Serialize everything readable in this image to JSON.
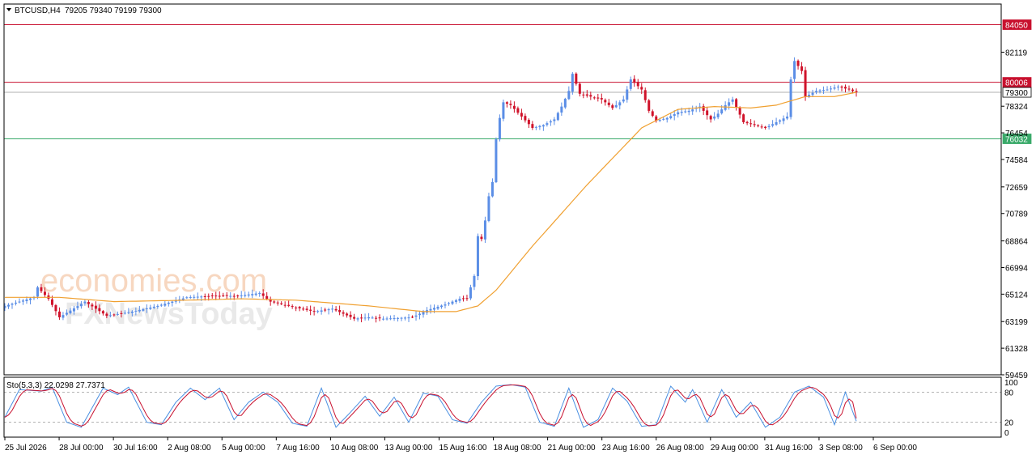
{
  "header": {
    "symbol_label": "BTCUSD,H4",
    "ohlc_label": "79205 79340 79199 79300"
  },
  "watermarks": [
    "economies.com",
    "FXNewsToday"
  ],
  "colors": {
    "bull": "#5b8ee6",
    "bear": "#d0122a",
    "ma": "#f0a030",
    "resistance": "#c8102e",
    "support": "#3aaa6a",
    "price_line": "#b0b0b0",
    "stoch_main": "#4a90e2",
    "stoch_signal": "#c8102e"
  },
  "chart_data": [
    {
      "type": "candlestick",
      "symbol": "BTCUSD",
      "timeframe": "H4",
      "ylim": [
        59459,
        85500
      ],
      "y_ticks": [
        "82119",
        "80006",
        "79300",
        "78324",
        "76454",
        "74584",
        "72659",
        "70789",
        "68864",
        "66994",
        "65124",
        "63199",
        "61328",
        "59459"
      ],
      "x_ticks": [
        "25 Jul 2026",
        "28 Jul 00:00",
        "30 Jul 16:00",
        "2 Aug 08:00",
        "5 Aug 00:00",
        "7 Aug 16:00",
        "10 Aug 08:00",
        "13 Aug 00:00",
        "15 Aug 16:00",
        "18 Aug 08:00",
        "21 Aug 00:00",
        "23 Aug 16:00",
        "26 Aug 08:00",
        "29 Aug 00:00",
        "31 Aug 16:00",
        "3 Sep 08:00",
        "6 Sep 00:00"
      ],
      "levels": [
        {
          "label": "84050",
          "value": 84050,
          "role": "resistance"
        },
        {
          "label": "80006",
          "value": 80006,
          "role": "resistance"
        },
        {
          "label": "79300",
          "value": 79300,
          "role": "current"
        },
        {
          "label": "76032",
          "value": 76032,
          "role": "support"
        }
      ],
      "close_anchors": [
        [
          0,
          64300
        ],
        [
          8,
          64900
        ],
        [
          9,
          65600
        ],
        [
          12,
          64800
        ],
        [
          15,
          63500
        ],
        [
          22,
          64600
        ],
        [
          28,
          63600
        ],
        [
          35,
          63900
        ],
        [
          42,
          64300
        ],
        [
          50,
          64900
        ],
        [
          57,
          65000
        ],
        [
          64,
          65000
        ],
        [
          70,
          65200
        ],
        [
          73,
          64600
        ],
        [
          78,
          64300
        ],
        [
          85,
          63900
        ],
        [
          90,
          64100
        ],
        [
          96,
          63400
        ],
        [
          100,
          63500
        ],
        [
          104,
          63400
        ],
        [
          112,
          63500
        ],
        [
          116,
          64000
        ],
        [
          121,
          64400
        ],
        [
          125,
          64800
        ],
        [
          127,
          64800
        ],
        [
          129,
          66400
        ],
        [
          130,
          69200
        ],
        [
          131,
          69000
        ],
        [
          132,
          70300
        ],
        [
          133,
          72000
        ],
        [
          134,
          73000
        ],
        [
          135,
          76000
        ],
        [
          136,
          77500
        ],
        [
          137,
          78600
        ],
        [
          139,
          78400
        ],
        [
          142,
          77600
        ],
        [
          145,
          76800
        ],
        [
          148,
          77000
        ],
        [
          151,
          77400
        ],
        [
          153,
          78300
        ],
        [
          155,
          79400
        ],
        [
          156,
          80600
        ],
        [
          158,
          79200
        ],
        [
          161,
          79000
        ],
        [
          164,
          78800
        ],
        [
          167,
          78200
        ],
        [
          170,
          78800
        ],
        [
          172,
          80200
        ],
        [
          175,
          79500
        ],
        [
          177,
          78000
        ],
        [
          179,
          77300
        ],
        [
          182,
          77500
        ],
        [
          185,
          77900
        ],
        [
          188,
          78000
        ],
        [
          191,
          78300
        ],
        [
          194,
          77400
        ],
        [
          196,
          77800
        ],
        [
          198,
          78400
        ],
        [
          200,
          78800
        ],
        [
          203,
          77200
        ],
        [
          206,
          77000
        ],
        [
          209,
          76800
        ],
        [
          212,
          77200
        ],
        [
          215,
          77600
        ],
        [
          216,
          80200
        ],
        [
          217,
          81500
        ],
        [
          219,
          80800
        ],
        [
          220,
          79000
        ],
        [
          223,
          79400
        ],
        [
          226,
          79500
        ],
        [
          229,
          79700
        ],
        [
          232,
          79500
        ],
        [
          234,
          79300
        ]
      ],
      "ma_anchors": [
        [
          0,
          64900
        ],
        [
          15,
          64900
        ],
        [
          30,
          64600
        ],
        [
          50,
          64700
        ],
        [
          65,
          64800
        ],
        [
          80,
          64700
        ],
        [
          100,
          64300
        ],
        [
          115,
          63900
        ],
        [
          124,
          63900
        ],
        [
          130,
          64300
        ],
        [
          135,
          65400
        ],
        [
          145,
          68500
        ],
        [
          160,
          72800
        ],
        [
          175,
          76800
        ],
        [
          185,
          78100
        ],
        [
          195,
          78300
        ],
        [
          205,
          78200
        ],
        [
          212,
          78400
        ],
        [
          220,
          79000
        ],
        [
          228,
          79000
        ],
        [
          234,
          79300
        ]
      ]
    },
    {
      "type": "line",
      "indicator": "Stochastic",
      "label": "Sto(5,3,3) 22.0298 27.7371",
      "ylim": [
        0,
        100
      ],
      "y_ticks": [
        "100",
        "80",
        "20",
        "0"
      ],
      "levels": [
        80,
        20
      ],
      "series": [
        {
          "name": "main",
          "last": 22.0298
        },
        {
          "name": "signal",
          "last": 27.7371
        }
      ],
      "main_anchors": [
        [
          0,
          30
        ],
        [
          4,
          85
        ],
        [
          10,
          82
        ],
        [
          13,
          90
        ],
        [
          17,
          20
        ],
        [
          21,
          10
        ],
        [
          27,
          88
        ],
        [
          31,
          75
        ],
        [
          34,
          90
        ],
        [
          39,
          20
        ],
        [
          43,
          15
        ],
        [
          47,
          60
        ],
        [
          51,
          88
        ],
        [
          55,
          65
        ],
        [
          59,
          88
        ],
        [
          63,
          25
        ],
        [
          67,
          60
        ],
        [
          71,
          80
        ],
        [
          75,
          60
        ],
        [
          79,
          18
        ],
        [
          83,
          12
        ],
        [
          87,
          88
        ],
        [
          91,
          10
        ],
        [
          95,
          40
        ],
        [
          99,
          72
        ],
        [
          103,
          32
        ],
        [
          107,
          70
        ],
        [
          111,
          20
        ],
        [
          115,
          78
        ],
        [
          119,
          72
        ],
        [
          123,
          25
        ],
        [
          127,
          18
        ],
        [
          131,
          60
        ],
        [
          135,
          92
        ],
        [
          139,
          95
        ],
        [
          143,
          90
        ],
        [
          147,
          20
        ],
        [
          151,
          12
        ],
        [
          155,
          88
        ],
        [
          159,
          10
        ],
        [
          163,
          25
        ],
        [
          167,
          88
        ],
        [
          171,
          62
        ],
        [
          175,
          12
        ],
        [
          179,
          15
        ],
        [
          183,
          92
        ],
        [
          187,
          60
        ],
        [
          189,
          85
        ],
        [
          193,
          20
        ],
        [
          197,
          85
        ],
        [
          201,
          30
        ],
        [
          205,
          60
        ],
        [
          209,
          10
        ],
        [
          213,
          30
        ],
        [
          217,
          80
        ],
        [
          221,
          92
        ],
        [
          225,
          70
        ],
        [
          228,
          15
        ],
        [
          231,
          80
        ],
        [
          234,
          22
        ]
      ]
    }
  ]
}
